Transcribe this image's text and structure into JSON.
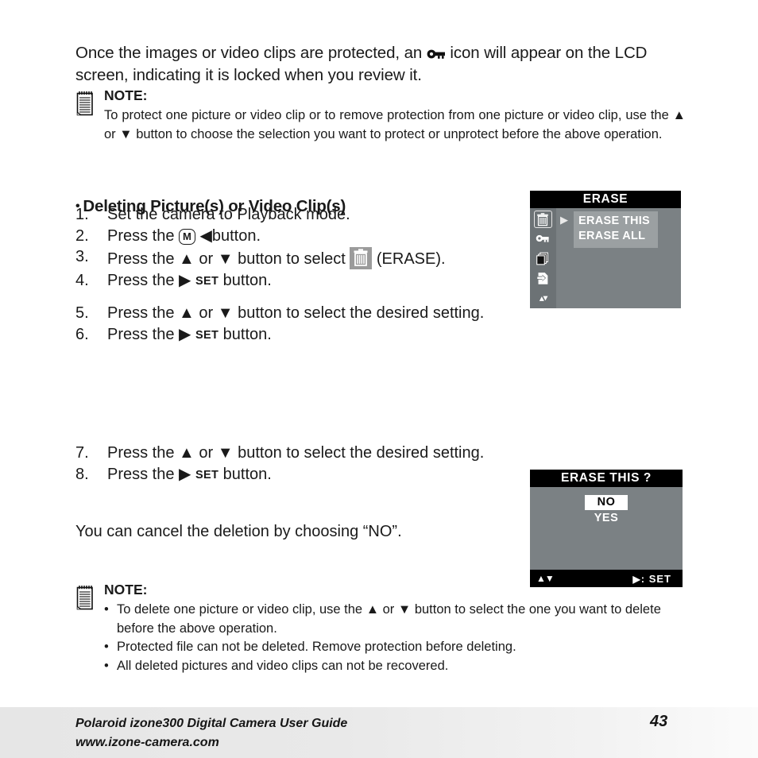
{
  "intro": {
    "before_icon": "Once the images or video clips are protected, an ",
    "icon": "key-icon",
    "after_icon": " icon will appear on the LCD screen, indicating it is locked when you review it."
  },
  "note_top": {
    "icon": "notepad-icon",
    "title": "NOTE:",
    "text_1": "To protect one picture or video clip or to remove protection from one picture or video clip, use the ",
    "arrow_up": "▲",
    "text_2": " or ",
    "arrow_down": "▼",
    "text_3": " button to choose the selection you want to protect or unprotect before the above operation."
  },
  "section": {
    "bullet": "•",
    "heading": "Deleting Picture(s) or Video Clip(s)"
  },
  "steps_group_1": [
    {
      "num": "1.",
      "text": "Set the camera to Playback mode."
    },
    {
      "num": "2.",
      "pre": "Press the ",
      "chip": "M",
      "mid": "",
      "arrow": "◀",
      "post": "button."
    },
    {
      "num": "3.",
      "pre": "Press the ",
      "arrow_up": "▲",
      "mid": " or ",
      "arrow_down": "▼",
      "post": " button to select ",
      "trash": "trash-icon",
      "tail": " (ERASE)."
    },
    {
      "num": "4.",
      "pre": "Press the ",
      "arrow": "▶",
      "set": "SET",
      "post": " button."
    }
  ],
  "steps_group_2": [
    {
      "num": "5.",
      "pre": "Press the ",
      "arrow_up": "▲",
      "mid": " or ",
      "arrow_down": "▼",
      "post": " button to select the desired setting."
    },
    {
      "num": "6.",
      "pre": "Press the ",
      "arrow": "▶",
      "set": "SET",
      "post": " button."
    }
  ],
  "steps_group_3": [
    {
      "num": "7.",
      "pre": "Press the ",
      "arrow_up": "▲",
      "mid": " or ",
      "arrow_down": "▼",
      "post": " button to select the desired setting."
    },
    {
      "num": "8.",
      "pre": "Press the ",
      "arrow": "▶",
      "set": "SET",
      "post": " button."
    }
  ],
  "cancel_note": "You can cancel the deletion by choosing “NO”.",
  "note_bottom": {
    "icon": "notepad-icon",
    "title": "NOTE:",
    "bullets": [
      {
        "bullet": "•",
        "text_1": "To delete one picture or video clip, use the ",
        "arrow_up": "▲",
        "text_2": " or ",
        "arrow_down": "▼",
        "text_3": " button to select the one you want to delete before the above operation."
      },
      {
        "bullet": "•",
        "text_1": "Protected file can not be deleted. Remove protection before deleting."
      },
      {
        "bullet": "•",
        "text_1": "All deleted pictures and video clips can not be recovered."
      }
    ]
  },
  "lcd_erase": {
    "title": "ERASE",
    "cursor": "▶",
    "sidebar_icons": [
      "trash-icon",
      "key-icon",
      "copy-icon",
      "transfer-icon",
      "updown-arrows-icon"
    ],
    "options": [
      "ERASE THIS",
      "ERASE ALL"
    ]
  },
  "lcd_confirm": {
    "title": "ERASE THIS ?",
    "option_no": "NO",
    "option_yes": "YES",
    "foot_left": "▲▼",
    "foot_right_arrow": "▶",
    "foot_right_text": ":  SET"
  },
  "footer": {
    "line1": "Polaroid izone300 Digital Camera User Guide",
    "line2": "www.izone-camera.com",
    "page_number": "43"
  },
  "colors": {
    "lcd_bg": "#7b8184",
    "lcd_sidebar": "#6c7275",
    "lcd_title_bg": "#000000",
    "highlight": "#9ba0a2",
    "footer_band": "#e6e6e6"
  }
}
